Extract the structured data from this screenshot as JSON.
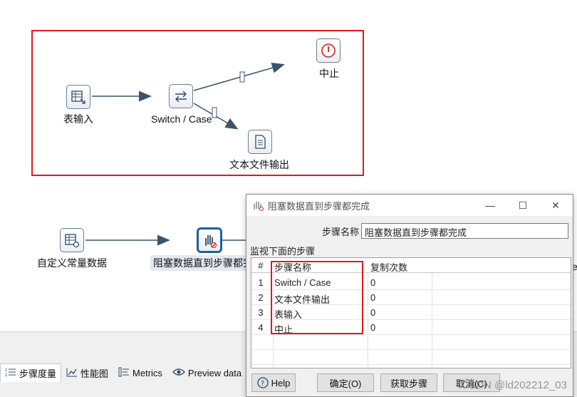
{
  "canvas": {
    "group1": {
      "nodes": {
        "table_input": "表输入",
        "switch_case": "Switch / Case",
        "abort": "中止",
        "text_file_output": "文本文件输出"
      }
    },
    "group2": {
      "nodes": {
        "custom_constant": "自定义常量数据",
        "blocking_step": "阻塞数据直到步骤都完",
        "partial_edge_text": "er"
      }
    }
  },
  "tabs": [
    {
      "label": "步骤度量",
      "icon": "step-metrics-icon"
    },
    {
      "label": "性能图",
      "icon": "performance-chart-icon"
    },
    {
      "label": "Metrics",
      "icon": "metrics-icon"
    },
    {
      "label": "Preview data",
      "icon": "eye-icon"
    }
  ],
  "dialog": {
    "title": "阻塞数据直到步骤都完成",
    "step_name_label": "步骤名称",
    "step_name_value": "阻塞数据直到步骤都完成",
    "monitor_label": "监视下面的步骤",
    "table": {
      "headers": [
        "#",
        "步骤名称",
        "复制次数"
      ],
      "rows": [
        [
          "1",
          "Switch / Case",
          "0"
        ],
        [
          "2",
          "文本文件输出",
          "0"
        ],
        [
          "3",
          "表输入",
          "0"
        ],
        [
          "4",
          "中止",
          "0"
        ]
      ]
    },
    "buttons": {
      "help": "Help",
      "ok": "确定(O)",
      "get_steps": "获取步骤",
      "cancel": "取消(C)"
    }
  },
  "watermark": "CSDN @ld202212_03",
  "colors": {
    "highlight": "#e0191e",
    "selected_border": "#1f5fa0"
  }
}
